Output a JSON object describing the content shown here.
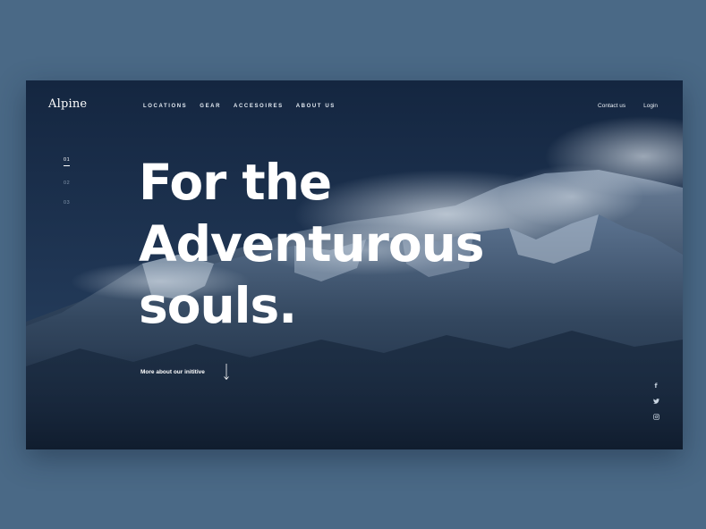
{
  "brand": {
    "logo_text": "Alpine"
  },
  "nav": {
    "items": [
      "LOCATIONS",
      "GEAR",
      "ACCESOIRES",
      "ABOUT US"
    ],
    "contact_label": "Contact us",
    "login_label": "Login"
  },
  "pager": {
    "items": [
      "01",
      "02",
      "03"
    ],
    "active": "01"
  },
  "hero": {
    "headline_lines": [
      "For the",
      "Adventurous",
      "souls."
    ],
    "cta_label": "More about our inititive"
  },
  "social": {
    "icons": [
      "facebook-icon",
      "twitter-icon",
      "instagram-icon"
    ],
    "facebook_glyph": "f"
  },
  "colors": {
    "page_bg": "#4a6986",
    "sky": "#1a2c44",
    "text": "#ffffff",
    "muted": "#8497ad"
  }
}
